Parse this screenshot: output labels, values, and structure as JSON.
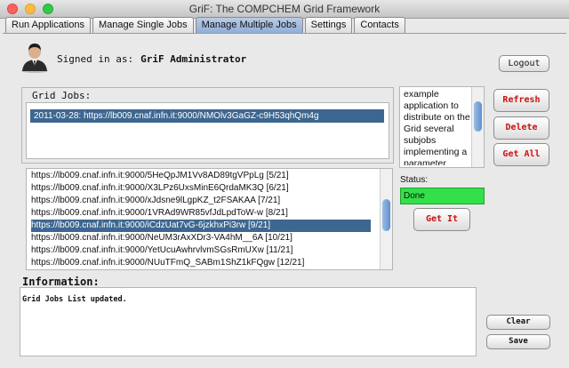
{
  "window": {
    "title": "GriF: The COMPCHEM Grid Framework"
  },
  "tabs": [
    {
      "label": "Run Applications"
    },
    {
      "label": "Manage Single Jobs"
    },
    {
      "label": "Manage Multiple Jobs",
      "active": true
    },
    {
      "label": "Settings"
    },
    {
      "label": "Contacts"
    }
  ],
  "user": {
    "signed_in_label": "Signed in as:",
    "name": "GriF Administrator",
    "logout_label": "Logout"
  },
  "grid_jobs": {
    "label": "Grid Jobs:",
    "items": [
      "2011-03-28: https://lb009.cnaf.infn.it:9000/NMOlv3GaGZ-c9H53qhQm4g"
    ],
    "selected_index": 0
  },
  "description": "example application to distribute on the Grid several subjobs implementing a parameter",
  "actions": {
    "refresh": "Refresh",
    "delete": "Delete",
    "get_all": "Get All",
    "get_it": "Get It"
  },
  "subjobs": {
    "items": [
      "https://lb009.cnaf.infn.it:9000/5HeQpJM1Vv8AD89tgVPpLg [5/21]",
      "https://lb009.cnaf.infn.it:9000/X3LPz6UxsMinE6QrdaMK3Q [6/21]",
      "https://lb009.cnaf.infn.it:9000/xJdsne9lLgpKZ_t2FSAKAA [7/21]",
      "https://lb009.cnaf.infn.it:9000/1VRAd9WR85vfJdLpdToW-w [8/21]",
      "https://lb009.cnaf.infn.it:9000/iCdzUat7vG-6jzkhxPi3rw [9/21]",
      "https://lb009.cnaf.infn.it:9000/NeUM3rAxXDr3-VA4hM__6A [10/21]",
      "https://lb009.cnaf.infn.it:9000/YetUcuAwhrvlvmSGsRmUXw [11/21]",
      "https://lb009.cnaf.infn.it:9000/NUuTFmQ_SABm1ShZ1kFQgw [12/21]"
    ],
    "selected_index": 4
  },
  "status": {
    "label": "Status:",
    "value": "Done",
    "color": "#33e04a"
  },
  "information": {
    "label": "Information:",
    "text": "Grid Jobs List updated.",
    "clear_label": "Clear",
    "save_label": "Save"
  },
  "colors": {
    "accent": "#3d6790",
    "danger_text": "#cc1111"
  }
}
